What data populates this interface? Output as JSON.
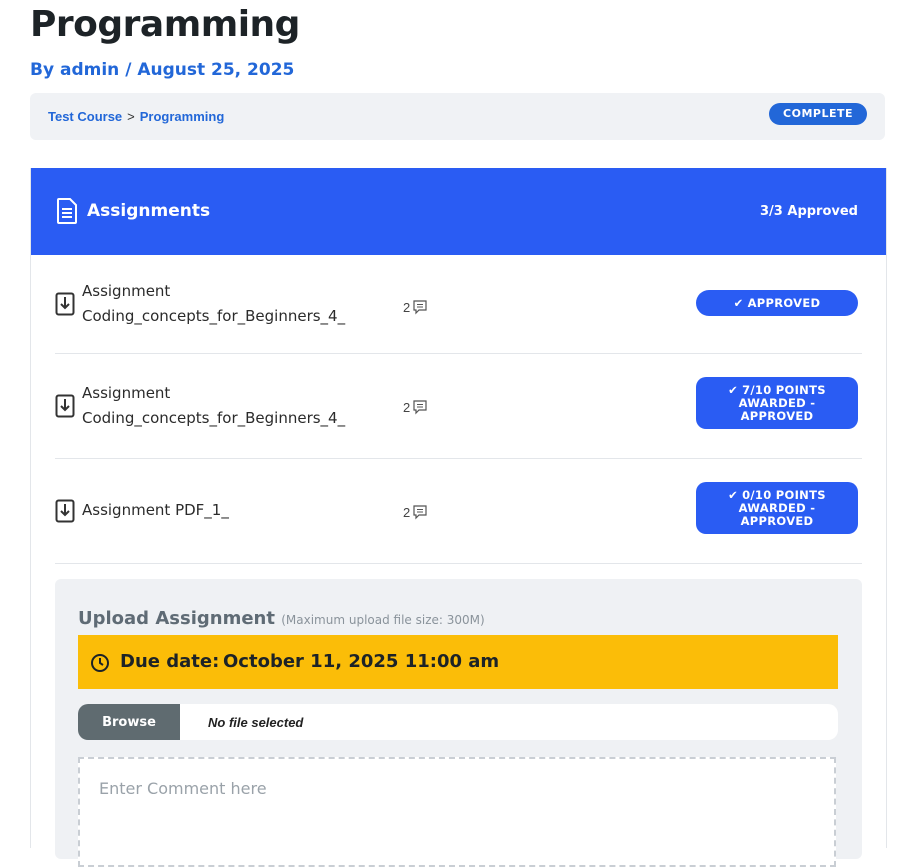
{
  "page": {
    "title": "Programming",
    "byline_prefix": "By",
    "author": "admin",
    "date_sep": "/",
    "date": "August 25, 2025"
  },
  "breadcrumb": {
    "course": "Test Course",
    "separator": ">",
    "lesson": "Programming",
    "status": "COMPLETE"
  },
  "assignments": {
    "icon": "document-icon",
    "title": "Assignments",
    "approved_count": "3/3 Approved",
    "items": [
      {
        "line1": "Assignment",
        "line2": "Coding_concepts_for_Beginners_4_",
        "comment_count": "2",
        "status_lines": [
          "APPROVED"
        ]
      },
      {
        "line1": "Assignment",
        "line2": "Coding_concepts_for_Beginners_4_",
        "comment_count": "2",
        "status_lines": [
          "7/10 POINTS",
          "AWARDED -",
          "APPROVED"
        ]
      },
      {
        "line1": "Assignment PDF_1_",
        "line2": "",
        "comment_count": "2",
        "status_lines": [
          "0/10 POINTS",
          "AWARDED -",
          "APPROVED"
        ]
      }
    ]
  },
  "upload": {
    "title": "Upload Assignment",
    "note": "(Maximum upload file size: 300M)",
    "due_label": "Due date:",
    "due_value": "October 11, 2025 11:00 am",
    "browse_label": "Browse",
    "file_status": "No file selected",
    "comment_placeholder": "Enter Comment here"
  },
  "colors": {
    "accent": "#2a5cf3",
    "link": "#2267d8",
    "due_bg": "#fbbd08",
    "browse_bg": "#5f6b70"
  }
}
